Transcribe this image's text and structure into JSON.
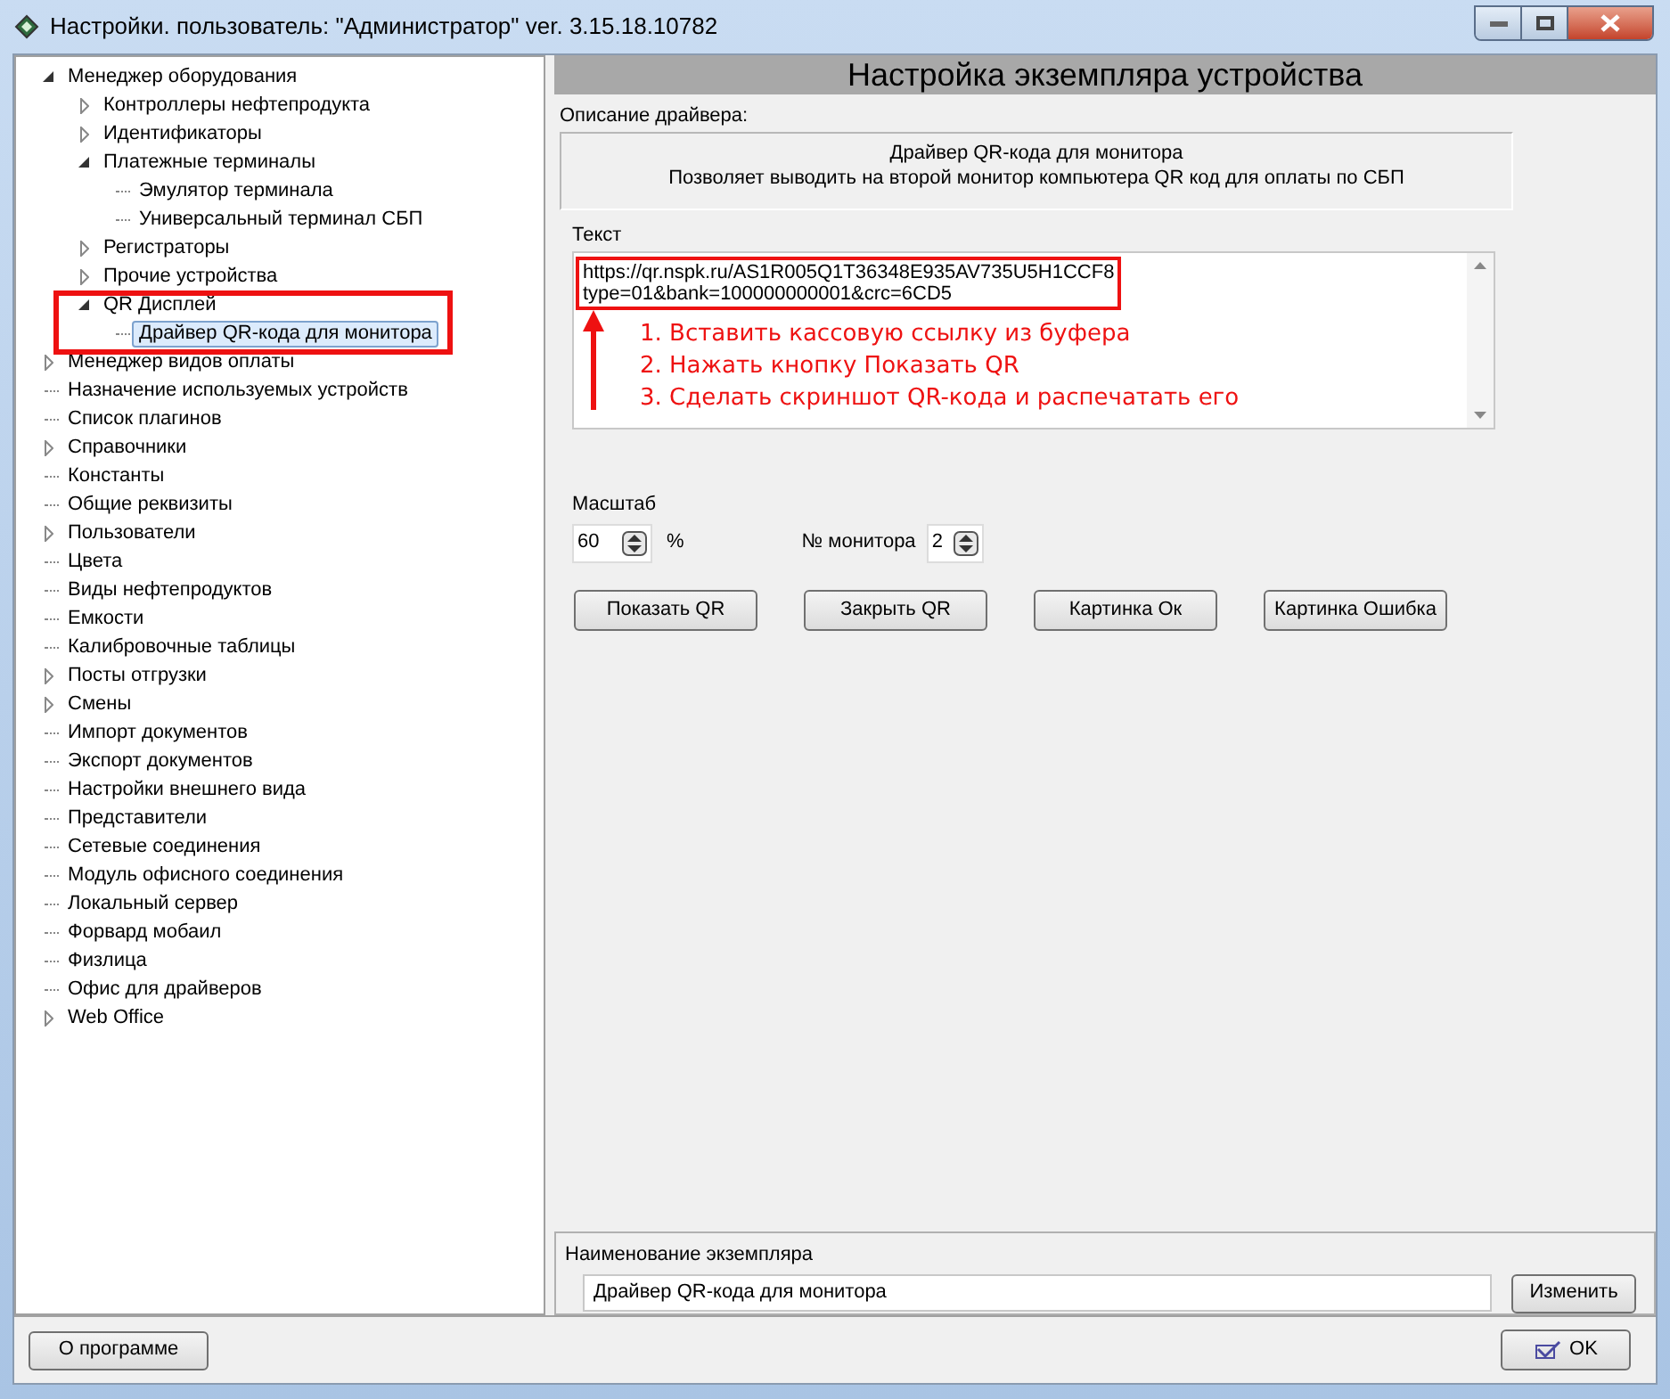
{
  "window": {
    "title": "Настройки. пользователь: \"Администратор\" ver. 3.15.18.10782"
  },
  "tree": [
    {
      "label": "Менеджер оборудования",
      "expanded": true,
      "selected": false,
      "children": [
        {
          "label": "Контроллеры нефтепродукта",
          "expanded": false,
          "selected": false
        },
        {
          "label": "Идентификаторы",
          "expanded": false,
          "selected": false
        },
        {
          "label": "Платежные терминалы",
          "expanded": true,
          "selected": false,
          "children": [
            {
              "label": "Эмулятор терминала",
              "selected": false
            },
            {
              "label": "Универсальный терминал СБП",
              "selected": false
            }
          ]
        },
        {
          "label": "Регистраторы",
          "expanded": false,
          "selected": false
        },
        {
          "label": "Прочие устройства",
          "expanded": false,
          "selected": false
        },
        {
          "label": "QR Дисплей",
          "expanded": true,
          "selected": false,
          "children": [
            {
              "label": "Драйвер QR-кода для монитора",
              "selected": true
            }
          ]
        }
      ]
    },
    {
      "label": "Менеджер видов оплаты",
      "expanded": false,
      "selected": false
    },
    {
      "label": "Назначение используемых устройств",
      "selected": false
    },
    {
      "label": "Список плагинов",
      "selected": false
    },
    {
      "label": "Справочники",
      "expanded": false,
      "selected": false
    },
    {
      "label": "Константы",
      "selected": false
    },
    {
      "label": "Общие реквизиты",
      "selected": false
    },
    {
      "label": "Пользователи",
      "expanded": false,
      "selected": false
    },
    {
      "label": "Цвета",
      "selected": false
    },
    {
      "label": "Виды нефтепродуктов",
      "selected": false
    },
    {
      "label": "Емкости",
      "selected": false
    },
    {
      "label": "Калибровочные таблицы",
      "selected": false
    },
    {
      "label": "Посты отгрузки",
      "expanded": false,
      "selected": false
    },
    {
      "label": "Смены",
      "expanded": false,
      "selected": false
    },
    {
      "label": "Импорт документов",
      "selected": false
    },
    {
      "label": "Экспорт документов",
      "selected": false
    },
    {
      "label": "Настройки внешнего вида",
      "selected": false
    },
    {
      "label": "Представители",
      "selected": false
    },
    {
      "label": "Сетевые соединения",
      "selected": false
    },
    {
      "label": "Модуль офисного соединения",
      "selected": false
    },
    {
      "label": "Локальный сервер",
      "selected": false
    },
    {
      "label": "Форвард мобаил",
      "selected": false
    },
    {
      "label": "Физлица",
      "selected": false
    },
    {
      "label": "Офис для драйверов",
      "selected": false
    },
    {
      "label": "Web Office",
      "expanded": false,
      "selected": false
    }
  ],
  "panel_title": "Настройка экземпляра устройства",
  "driver_description": {
    "label": "Описание драйвера:",
    "lines": [
      "Драйвер QR-кода для монитора",
      "Позволяет выводить на второй монитор компьютера QR код для оплаты по СБП"
    ]
  },
  "text_field": {
    "label": "Текст",
    "lines": [
      "https://qr.nspk.ru/AS1R005Q1T36348E935AV735U5H1CCF8",
      "type=01&bank=100000000001&crc=6CD5"
    ]
  },
  "instructions": [
    "1. Вставить кассовую ссылку из буфера",
    "2. Нажать кнопку Показать QR",
    "3. Сделать скриншот QR-кода и распечатать его"
  ],
  "scale": {
    "label": "Масштаб",
    "value": "60",
    "unit": "%"
  },
  "monitor": {
    "label": "№ монитора",
    "value": "2"
  },
  "buttons": [
    "Показать QR",
    "Закрыть QR",
    "Картинка Ок",
    "Картинка Ошибка"
  ],
  "instance_name": {
    "label": "Наименование экземпляра",
    "value": "Драйвер QR-кода для монитора",
    "button": "Изменить"
  },
  "footer": {
    "about_button": "О программе",
    "ok_button": "OK"
  }
}
